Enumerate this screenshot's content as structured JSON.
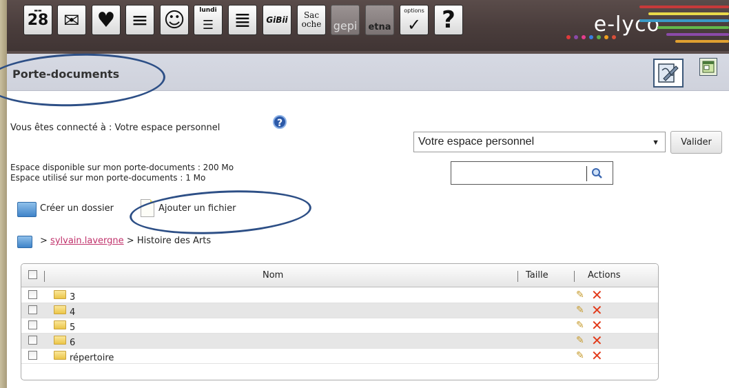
{
  "toolbar": {
    "tools": [
      {
        "id": "agenda",
        "icon": "calendar-icon",
        "text": "28"
      },
      {
        "id": "messagerie",
        "icon": "envelope-icon",
        "text": "✉"
      },
      {
        "id": "favoris",
        "icon": "heart-icon",
        "text": "♥"
      },
      {
        "id": "cahier",
        "icon": "notebook-icon",
        "text": "≡"
      },
      {
        "id": "annuaire",
        "icon": "contacts-icon",
        "text": "☺"
      },
      {
        "id": "edt",
        "icon": "schedule-icon",
        "text": "lundi"
      },
      {
        "id": "classeur",
        "icon": "binder-icon",
        "text": "≣"
      },
      {
        "id": "gibii",
        "icon": "gibii-icon",
        "text": "GiBii"
      },
      {
        "id": "sacoche",
        "icon": "sacoche-icon",
        "text": "Sac oche"
      },
      {
        "id": "gepi",
        "icon": "gepi-icon",
        "text": "gepi"
      },
      {
        "id": "etna",
        "icon": "etna-icon",
        "text": "etna"
      },
      {
        "id": "options",
        "icon": "checkmark-icon",
        "text": "options"
      },
      {
        "id": "aide",
        "icon": "help-icon",
        "text": "?"
      }
    ],
    "brand": "e-lyco",
    "dot_colors": [
      "#e03a3a",
      "#8a4aa8",
      "#e43d8e",
      "#3a7ee0",
      "#5fb14a",
      "#f0a020",
      "#d94f3a"
    ]
  },
  "page": {
    "title": "Porte-documents"
  },
  "connection": {
    "label": "Vous êtes connecté à : Votre espace personnel"
  },
  "space_select": {
    "value": "Votre espace personnel",
    "submit_label": "Valider"
  },
  "quota": {
    "available": "Espace disponible sur mon porte-documents :  200 Mo",
    "used": "Espace utilisé sur mon porte-documents :  1 Mo"
  },
  "actions": {
    "create_folder": "Créer un dossier",
    "add_file": "Ajouter un fichier"
  },
  "breadcrumb": {
    "separator1": ">",
    "user": "sylvain.lavergne",
    "separator2": ">",
    "current": "Histoire des Arts"
  },
  "table": {
    "columns": {
      "name": "Nom",
      "size": "Taille",
      "actions": "Actions"
    },
    "rows": [
      {
        "name": "3"
      },
      {
        "name": "4"
      },
      {
        "name": "5"
      },
      {
        "name": "6"
      },
      {
        "name": "répertoire"
      }
    ]
  },
  "colors": {
    "link": "#c0306a",
    "annotation": "#2d4f86",
    "delete": "#e23a1a"
  }
}
